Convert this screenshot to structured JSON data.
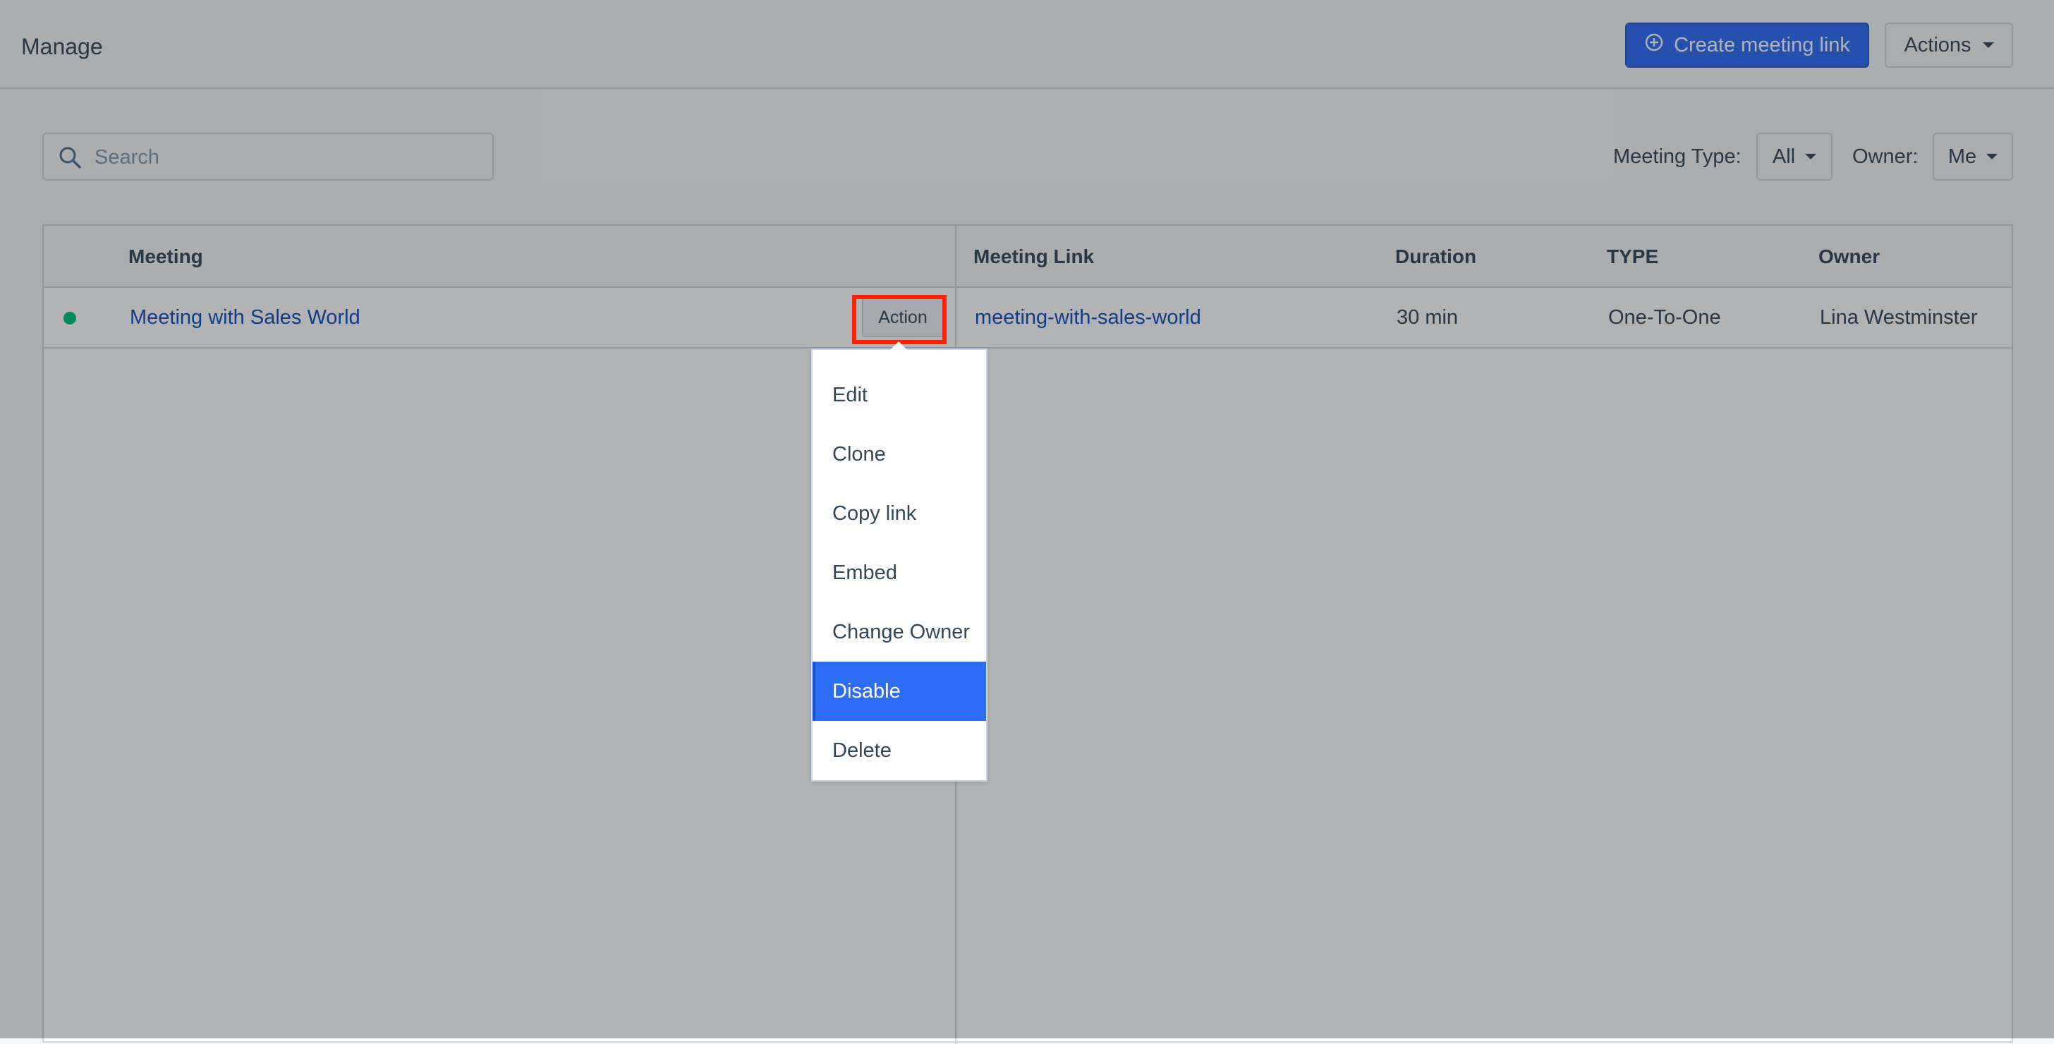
{
  "header": {
    "title": "Manage",
    "create_button": "Create meeting link",
    "actions_button": "Actions"
  },
  "toolbar": {
    "search_placeholder": "Search",
    "meeting_type_label": "Meeting Type:",
    "meeting_type_value": "All",
    "owner_label": "Owner:",
    "owner_value": "Me"
  },
  "table": {
    "columns": [
      "Meeting",
      "Meeting Link",
      "Duration",
      "TYPE",
      "Owner"
    ],
    "rows": [
      {
        "status": "active",
        "meeting": "Meeting with Sales World",
        "action_label": "Action",
        "link": "meeting-with-sales-world",
        "duration": "30 min",
        "type": "One-To-One",
        "owner": "Lina Westminster"
      }
    ]
  },
  "action_menu": {
    "items": [
      "Edit",
      "Clone",
      "Copy link",
      "Embed",
      "Change Owner",
      "Disable",
      "Delete"
    ],
    "highlighted": "Disable"
  },
  "colors": {
    "primary": "#2d6cf5",
    "link": "#0f4fb3",
    "status_active": "#00bf7a",
    "highlight_box": "#ff2200"
  },
  "icons": {
    "create": "plus-circle-icon",
    "search": "search-icon",
    "caret": "caret-down-icon"
  }
}
